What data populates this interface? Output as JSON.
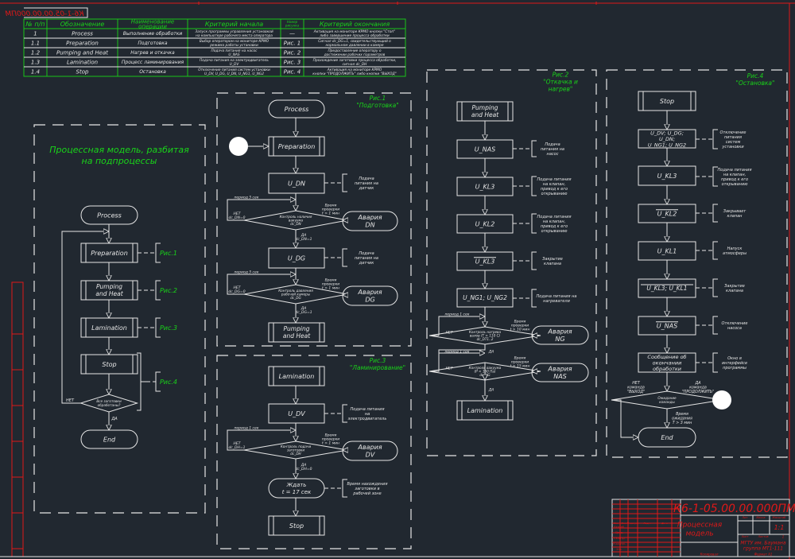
{
  "colors": {
    "background": "#212830",
    "lines": "#e6e6e6",
    "labels": "#19d419",
    "frame": "#e01818"
  },
  "drawing_code": "К6-1-05.00.00.000ПМ",
  "table": {
    "headers": [
      [
        "№ п/п"
      ],
      [
        "Обозначение"
      ],
      [
        "Наименование",
        "операции"
      ],
      [
        "Критерий начала"
      ],
      [
        "Номер",
        "рисунка"
      ],
      [
        "Критерий окончания"
      ]
    ],
    "rows": [
      [
        [
          "1"
        ],
        [
          "Process"
        ],
        [
          "Выполнение обработки"
        ],
        [
          "Запуск программы управления установкой",
          "на компьютере рабочего места оператора"
        ],
        [
          "—"
        ],
        [
          "Активация на мониторе КРМО кнопки \"Стоп\"",
          "либо завершение процесса обработки"
        ]
      ],
      [
        [
          "1.1"
        ],
        [
          "Preparation"
        ],
        [
          "Подготовка"
        ],
        [
          "Выбор оператором на мониторе КРМО",
          "режима работы установки"
        ],
        [
          "Рис. 1"
        ],
        [
          "Сигнал dc_DG=1, свидетельствующий о",
          "нормальном давлении в камере"
        ]
      ],
      [
        [
          "1.2"
        ],
        [
          "Pumping and Heat"
        ],
        [
          "Нагрев и откачка"
        ],
        [
          "Подача питания на насос",
          "U_NAS"
        ],
        [
          "Рис. 2"
        ],
        [
          "Предоставление оператору о",
          "достижении рабочих параметров"
        ]
      ],
      [
        [
          "1.3"
        ],
        [
          "Lamination"
        ],
        [
          "Процесс ламинирования"
        ],
        [
          "Подача питания на электродвигатель",
          "U_DV"
        ],
        [
          "Рис. 3"
        ],
        [
          "Прохождение заготовки процесса обработки,",
          "сигнал dc_DH"
        ]
      ],
      [
        [
          "1.4"
        ],
        [
          "Stop"
        ],
        [
          "Остановка"
        ],
        [
          "Отключение питания систем установки",
          "U_DV, U_DG, U_DN, U_NG1, U_NG2"
        ],
        [
          "Рис. 4"
        ],
        [
          "Активация на мониторе КРМО",
          "кнопки \"ПРОДОЛЖИТЬ\" либо кнопки \"ВЫХОД\""
        ]
      ]
    ]
  },
  "main": {
    "title": [
      "Процессная модель, разбитая",
      "на подпроцессы"
    ],
    "process": [
      "Process"
    ],
    "preparation": [
      "Preparation"
    ],
    "pumping": [
      "Pumping",
      "and Heat"
    ],
    "lamination": [
      "Lamination"
    ],
    "stop": [
      "Stop"
    ],
    "decision": [
      "Все заготовки",
      "обработаны?"
    ],
    "no": [
      "НЕТ"
    ],
    "yes": [
      "ДА"
    ],
    "end": [
      "End"
    ],
    "refs": [
      [
        "Рис.1"
      ],
      [
        "Рис.2"
      ],
      [
        "Рис.3"
      ],
      [
        "Рис.4"
      ]
    ]
  },
  "fig1": {
    "title": [
      "Рис.1",
      "\"Подготовка\""
    ],
    "process": [
      "Process"
    ],
    "preparation": [
      "Preparation"
    ],
    "u_dn": [
      "U_DN"
    ],
    "note_dn": [
      "Подача",
      "питания на",
      "датчик"
    ],
    "period1": [
      "период 5 сек"
    ],
    "no1": [
      "НЕТ",
      "dc_DN=0"
    ],
    "dec1": [
      "Контроль наличия",
      "вакуума",
      "dc_DN"
    ],
    "time1": [
      "Время",
      "проверки",
      "t > 1 мин"
    ],
    "alarm_dn": [
      "Авария",
      "DN"
    ],
    "yes1": [
      "ДА",
      "dc_DN=1"
    ],
    "u_dg": [
      "U_DG"
    ],
    "note_dg": [
      "Подача",
      "питания на",
      "датчик"
    ],
    "period2": [
      "период 5 сек"
    ],
    "no2": [
      "НЕТ",
      "dc_DG=0"
    ],
    "dec2": [
      "Контроль давления",
      "рабочей камеры",
      "dc_DG"
    ],
    "time2": [
      "Время",
      "проверки",
      "t > 1 мин"
    ],
    "alarm_dg": [
      "Авария",
      "DG"
    ],
    "yes2": [
      "ДА",
      "dc_DG=1"
    ],
    "pumping": [
      "Pumping",
      "and Heat"
    ]
  },
  "fig2": {
    "title": [
      "Рис.2",
      "\"Откачка и",
      "нагрев\""
    ],
    "pumping": [
      "Pumping",
      "and Heat"
    ],
    "u_nas": [
      "U_NAS"
    ],
    "note_nas": [
      "Подача",
      "питания на",
      "насос"
    ],
    "u_kl3": [
      "U_KL3"
    ],
    "note_kl3": [
      "Подача питания",
      "на клапан,",
      "привод к его",
      "открыванию"
    ],
    "u_kl2": [
      "U_KL2"
    ],
    "note_kl2": [
      "Подача питания",
      "на клапан,",
      "привод к его",
      "открыванию"
    ],
    "u_kl3_off": [
      "U_KL3"
    ],
    "note_kl3_off": [
      "Закрытие",
      "клапана"
    ],
    "u_ng": [
      "U_NG1;  U_NG2"
    ],
    "note_ng": [
      "Подача питания на",
      "нагреватели"
    ],
    "period1": [
      "период 1 сек"
    ],
    "no1": [
      "НЕТ"
    ],
    "dec1": [
      "Контроль нагрева",
      "валов (T > 110 C)",
      "dc_DT1..2"
    ],
    "time1": [
      "Время",
      "проверки",
      "t > 10 мин"
    ],
    "alarm_ng": [
      "Авария",
      "NG"
    ],
    "yes1": [
      "ДА"
    ],
    "period2": [
      "период 1 сек"
    ],
    "no2": [
      "НЕТ"
    ],
    "dec2": [
      "Контроль вакуума",
      "(P < 150 Па)",
      "dc_VG"
    ],
    "time2": [
      "Время",
      "проверки",
      "t > 15 мин"
    ],
    "alarm_nas": [
      "Авария",
      "NAS"
    ],
    "yes2": [
      "ДА"
    ],
    "lamination": [
      "Lamination"
    ]
  },
  "fig3": {
    "title": [
      "Рис.3",
      "\"Ламинирование\""
    ],
    "lamination": [
      "Lamination"
    ],
    "u_dv": [
      "U_DV"
    ],
    "note_dv": [
      "Подача питания",
      "на",
      "электродвигатель"
    ],
    "period": [
      "период 1 сек"
    ],
    "no": [
      "НЕТ",
      "dc_DH=1"
    ],
    "dec": [
      "Контроль подачи",
      "заготовки",
      "dc_DH"
    ],
    "time": [
      "Время",
      "проверки",
      "t > 1 мин"
    ],
    "alarm_dv": [
      "Авария",
      "DV"
    ],
    "yes": [
      "ДА",
      "dc_DH=0"
    ],
    "wait": [
      "Ждать",
      "t = 17 сек"
    ],
    "note_wait": [
      "Время нахождения",
      "заготовки в",
      "рабочей зоне"
    ],
    "stop": [
      "Stop"
    ]
  },
  "fig4": {
    "title": [
      "Рис.4",
      "\"Остановка\""
    ],
    "stop": [
      "Stop"
    ],
    "off_all": [
      "U_DV; U_DG;",
      "U_DN;",
      "U_NG1; U_NG2"
    ],
    "note_off": [
      "Отключение",
      "питания",
      "систем",
      "установки"
    ],
    "u_kl3": [
      "U_KL3"
    ],
    "note_kl3": [
      "Подача питания",
      "на клапан,",
      "привод к его",
      "открыванию"
    ],
    "u_kl2": [
      "U_KL2"
    ],
    "note_kl2": [
      "Закрывает",
      "клапан"
    ],
    "u_kl1": [
      "U_KL1"
    ],
    "note_kl1": [
      "Напуск",
      "атмосферы"
    ],
    "u_kl3_kl1": [
      "U_KL3;  U_KL1"
    ],
    "note_kl3_kl1": [
      "Закрытие",
      "клапана"
    ],
    "u_nas": [
      "U_NAS"
    ],
    "note_nas": [
      "Отключение",
      "насоса"
    ],
    "msg": [
      "Сообщение об",
      "окончании",
      "обработки"
    ],
    "note_msg": [
      "Окно в",
      "интерфейсе",
      "программы"
    ],
    "no": [
      "НЕТ",
      "команда",
      "\"ВЫХОД\""
    ],
    "yes": [
      "ДА",
      "команда",
      "\"ПРОДОЛЖИТЬ\""
    ],
    "dec": [
      "Ожидание",
      "команды"
    ],
    "wait": [
      "Время",
      "ожидания",
      "T > 3 мин"
    ],
    "end": [
      "End"
    ]
  },
  "title_block": {
    "code": [
      "К6-1-05.00.00.000ПМ"
    ],
    "name": [
      "Процессная",
      "модель"
    ],
    "cols": [
      [
        "Изм"
      ],
      [
        "Лист"
      ],
      [
        "№ докум."
      ],
      [
        "Подп."
      ],
      [
        "Дата"
      ]
    ],
    "roles": [
      [
        "Разраб."
      ],
      [
        "Пров."
      ],
      [
        "Т.контр."
      ],
      [
        "Н.контр."
      ],
      [
        "Утв."
      ]
    ],
    "lit": [
      "Лит"
    ],
    "mass": [
      "Масса"
    ],
    "scale_label": [
      "Масштаб"
    ],
    "scale": [
      "1:1"
    ],
    "sheet": [
      "Лист"
    ],
    "sheets": [
      "Листов"
    ],
    "sheets_count": [
      "1"
    ],
    "org": [
      "МГТУ им. Баумана",
      "группа МТ1-111"
    ],
    "copied": [
      "Копировал"
    ],
    "format": [
      "Формат  А1"
    ]
  }
}
